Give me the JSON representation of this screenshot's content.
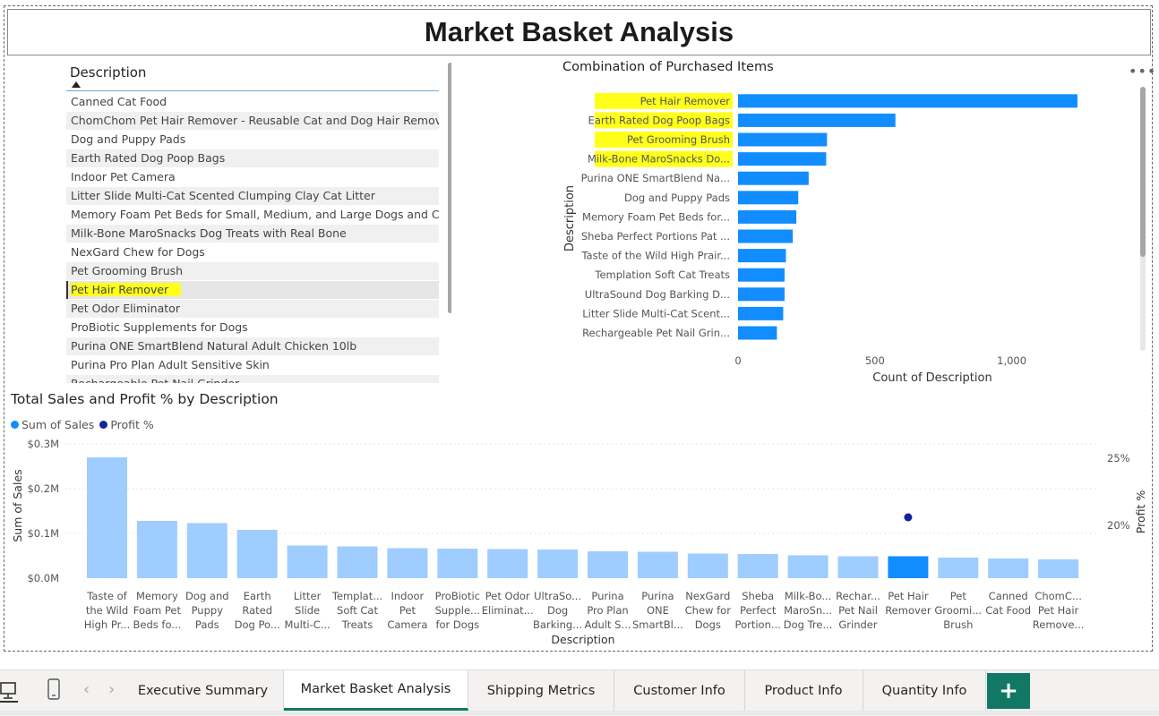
{
  "page": {
    "title": "Market Basket Analysis"
  },
  "slicer": {
    "header": "Description",
    "items": [
      {
        "label": "Canned Cat Food",
        "selected": false
      },
      {
        "label": "ChomChom Pet Hair Remover - Reusable Cat and Dog Hair Remover",
        "selected": false
      },
      {
        "label": "Dog and Puppy Pads",
        "selected": false
      },
      {
        "label": "Earth Rated Dog Poop Bags",
        "selected": false
      },
      {
        "label": "Indoor Pet Camera",
        "selected": false
      },
      {
        "label": "Litter Slide Multi-Cat Scented Clumping Clay Cat Litter",
        "selected": false
      },
      {
        "label": "Memory Foam Pet Beds for Small, Medium, and Large Dogs and Cats",
        "selected": false
      },
      {
        "label": "Milk-Bone MaroSnacks Dog Treats with Real Bone",
        "selected": false
      },
      {
        "label": "NexGard Chew for Dogs",
        "selected": false
      },
      {
        "label": "Pet Grooming Brush",
        "selected": false
      },
      {
        "label": "Pet Hair Remover",
        "selected": true
      },
      {
        "label": "Pet Odor Eliminator",
        "selected": false
      },
      {
        "label": "ProBiotic Supplements for Dogs",
        "selected": false
      },
      {
        "label": "Purina ONE SmartBlend Natural Adult Chicken 10lb",
        "selected": false
      },
      {
        "label": "Purina Pro Plan Adult Sensitive Skin",
        "selected": false
      },
      {
        "label": "Rechargeable Pet Nail Grinder",
        "selected": false
      }
    ]
  },
  "chart_data": [
    {
      "type": "bar",
      "orientation": "horizontal",
      "title": "Combination of Purchased Items",
      "xlabel": "Count of Description",
      "ylabel": "Description",
      "categories": [
        "Pet Hair Remover",
        "Earth Rated Dog Poop Bags",
        "Pet Grooming Brush",
        "Milk-Bone MaroSnacks Do...",
        "Purina ONE SmartBlend Na...",
        "Dog and Puppy Pads",
        "Memory Foam Pet Beds for...",
        "Sheba Perfect Portions Pat ...",
        "Taste of the Wild High Prair...",
        "Templation Soft Cat Treats",
        "UltraSound Dog Barking D...",
        "Litter Slide Multi-Cat Scent...",
        "Rechargeable Pet Nail Grin..."
      ],
      "values": [
        1240,
        575,
        325,
        322,
        258,
        220,
        213,
        200,
        175,
        170,
        170,
        165,
        142
      ],
      "highlighted": [
        "Pet Hair Remover",
        "Earth Rated Dog Poop Bags",
        "Pet Grooming Brush",
        "Milk-Bone MaroSnacks Do..."
      ],
      "xticks": [
        "0",
        "500",
        "1,000"
      ],
      "xlim": [
        0,
        1250
      ],
      "bar_color": "#118dff",
      "highlight_color": "#ffff1a",
      "grid": false
    },
    {
      "type": "bar",
      "title": "Total Sales and Profit % by Description",
      "xlabel": "Description",
      "ylabel": "Sum of Sales",
      "y2label": "Profit %",
      "legend": [
        {
          "name": "Sum of Sales",
          "color": "#118dff"
        },
        {
          "name": "Profit %",
          "color": "#12239e"
        }
      ],
      "legend_position": "top-left",
      "categories": [
        [
          "Taste of",
          "the Wild",
          "High Pr..."
        ],
        [
          "Memory",
          "Foam Pet",
          "Beds fo..."
        ],
        [
          "Dog and",
          "Puppy",
          "Pads"
        ],
        [
          "Earth",
          "Rated",
          "Dog Po..."
        ],
        [
          "Litter",
          "Slide",
          "Multi-C..."
        ],
        [
          "Templat...",
          "Soft Cat",
          "Treats"
        ],
        [
          "Indoor",
          "Pet",
          "Camera"
        ],
        [
          "ProBiotic",
          "Supple...",
          "for Dogs"
        ],
        [
          "Pet Odor",
          "Eliminat..."
        ],
        [
          "UltraSo...",
          "Dog",
          "Barking..."
        ],
        [
          "Purina",
          "Pro Plan",
          "Adult S..."
        ],
        [
          "Purina",
          "ONE",
          "SmartBl..."
        ],
        [
          "NexGard",
          "Chew for",
          "Dogs"
        ],
        [
          "Sheba",
          "Perfect",
          "Portion..."
        ],
        [
          "Milk-Bo...",
          "MaroSn...",
          "Dog Tre..."
        ],
        [
          "Rechar...",
          "Pet Nail",
          "Grinder"
        ],
        [
          "Pet Hair",
          "Remover"
        ],
        [
          "Pet",
          "Groomi...",
          "Brush"
        ],
        [
          "Canned",
          "Cat Food"
        ],
        [
          "ChomC...",
          "Pet Hair",
          "Remove..."
        ]
      ],
      "series": [
        {
          "name": "Sum of Sales",
          "values": [
            0.27,
            0.128,
            0.123,
            0.108,
            0.073,
            0.071,
            0.067,
            0.066,
            0.065,
            0.064,
            0.06,
            0.059,
            0.055,
            0.054,
            0.051,
            0.049,
            0.049,
            0.046,
            0.044,
            0.042
          ]
        },
        {
          "name": "Profit %",
          "values": [
            null,
            null,
            null,
            null,
            null,
            null,
            null,
            null,
            null,
            null,
            null,
            null,
            null,
            null,
            null,
            null,
            20.6,
            null,
            null,
            null
          ]
        }
      ],
      "selected_index": 16,
      "yticks": [
        "$0.0M",
        "$0.1M",
        "$0.2M",
        "$0.3M"
      ],
      "ylim": [
        0,
        0.3
      ],
      "y2ticks": [
        "20%",
        "25%"
      ],
      "y2lim": [
        16,
        26
      ],
      "bar_color_faded": "#9fcdff",
      "bar_color": "#118dff",
      "point_color": "#12239e",
      "grid": true
    }
  ],
  "tabs": [
    {
      "label": "Executive Summary",
      "active": false
    },
    {
      "label": "Market Basket Analysis",
      "active": true
    },
    {
      "label": "Shipping Metrics",
      "active": false
    },
    {
      "label": "Customer Info",
      "active": false
    },
    {
      "label": "Product Info",
      "active": false
    },
    {
      "label": "Quantity Info",
      "active": false
    }
  ],
  "icons": {
    "add_tab": "+",
    "more": "•••",
    "prev": "‹",
    "next": "›"
  }
}
